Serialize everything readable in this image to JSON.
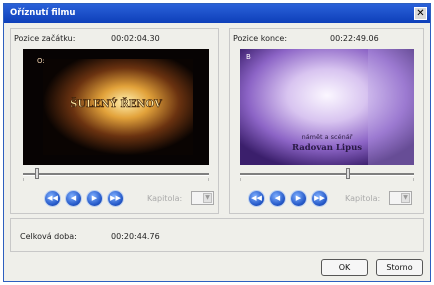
{
  "window": {
    "title": "Oříznutí filmu",
    "close_symbol": "✕"
  },
  "start": {
    "label": "Pozice začátku:",
    "time": "00:02:04.30",
    "video_text": "ŠULENÝ ŘENOV",
    "chapter_label": "Kapitola:",
    "slider_position": 0.07
  },
  "end": {
    "label": "Pozice konce:",
    "time": "00:22:49.06",
    "video_text_line1": "námět a scénář",
    "video_text_line2": "Radovan Lipus",
    "chapter_label": "Kapitola:",
    "slider_position": 0.61
  },
  "total": {
    "label": "Celková doba:",
    "value": "00:20:44.76"
  },
  "buttons": {
    "ok": "OK",
    "cancel": "Storno"
  },
  "controls": {
    "rewind_icon": "rewind-icon",
    "step_back_icon": "step-back-icon",
    "step_forward_icon": "step-forward-icon",
    "fast_forward_icon": "fast-forward-icon"
  }
}
